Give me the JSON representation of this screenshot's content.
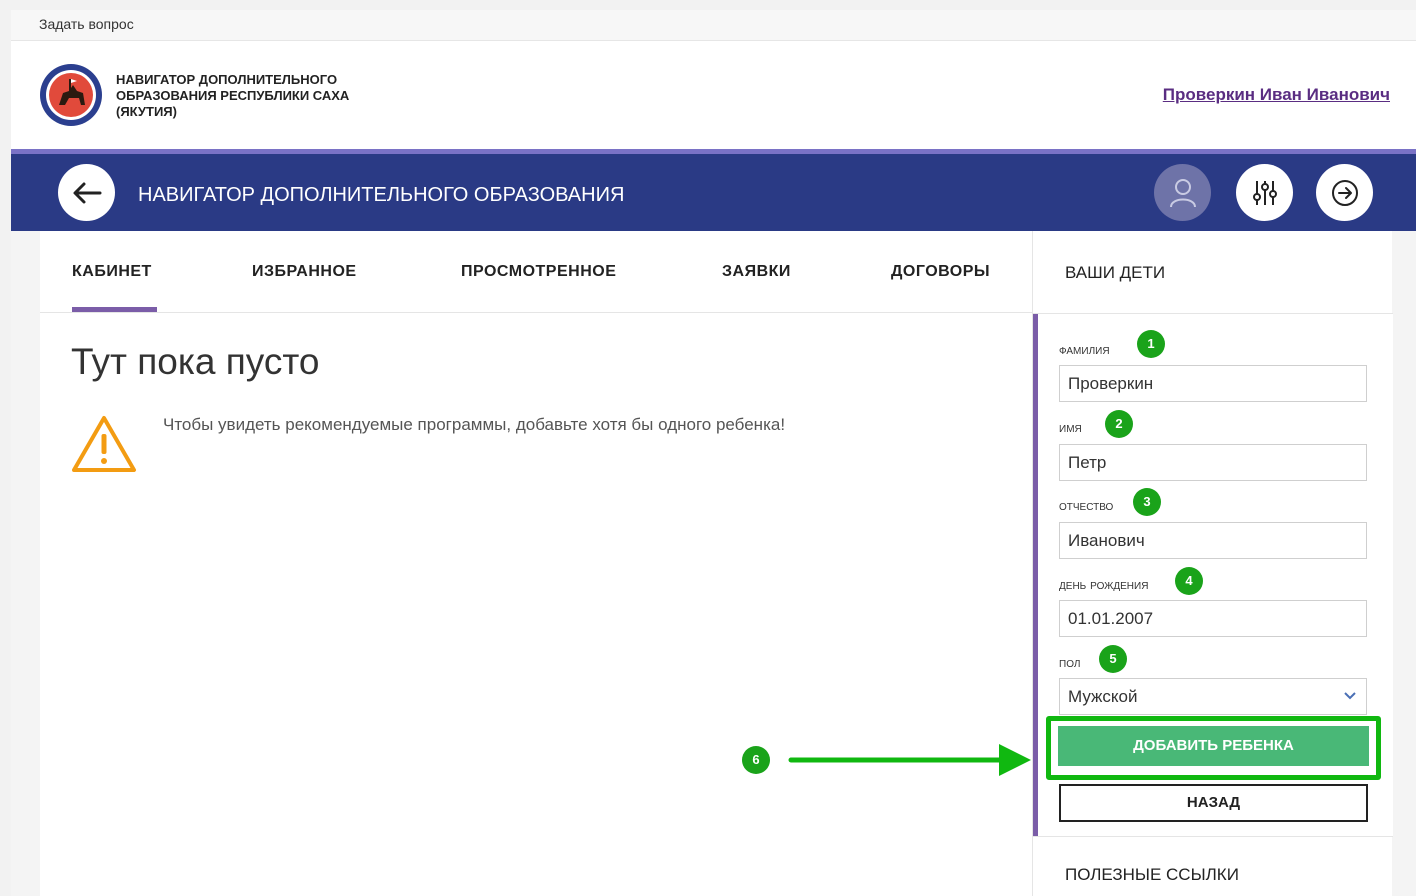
{
  "topbar": {
    "ask_question": "Задать вопрос"
  },
  "header": {
    "org_line1": "НАВИГАТОР ДОПОЛНИТЕЛЬНОГО",
    "org_line2": "ОБРАЗОВАНИЯ РЕСПУБЛИКИ САХА",
    "org_line3": "(ЯКУТИЯ)",
    "user_name": "Проверкин Иван Иванович"
  },
  "navbar": {
    "title": "НАВИГАТОР ДОПОЛНИТЕЛЬНОГО ОБРАЗОВАНИЯ"
  },
  "tabs": [
    {
      "label": "КАБИНЕТ"
    },
    {
      "label": "ИЗБРАННОЕ"
    },
    {
      "label": "ПРОСМОТРЕННОЕ"
    },
    {
      "label": "ЗАЯВКИ"
    },
    {
      "label": "ДОГОВОРЫ"
    }
  ],
  "main": {
    "empty_title": "Тут пока пусто",
    "empty_text": "Чтобы увидеть рекомендуемые программы, добавьте хотя бы одного ребенка!"
  },
  "sidebar": {
    "title": "ВАШИ ДЕТИ",
    "fields": [
      {
        "label": "фамилия",
        "value": "Проверкин",
        "badge": "1"
      },
      {
        "label": "имя",
        "value": "Петр",
        "badge": "2"
      },
      {
        "label": "отчество",
        "value": "Иванович",
        "badge": "3"
      },
      {
        "label": "день рождения",
        "value": "01.01.2007",
        "badge": "4"
      },
      {
        "label": "пол",
        "value": "Мужской",
        "badge": "5"
      }
    ],
    "add_button": "ДОБАВИТЬ РЕБЕНКА",
    "back_button": "НАЗАД",
    "links_title": "ПОЛЕЗНЫЕ ССЫЛКИ"
  },
  "annotation": {
    "step6": "6"
  },
  "colors": {
    "navbar": "#2a3a85",
    "accent": "#7b5da8",
    "green": "#10b810",
    "button": "#49b877"
  }
}
